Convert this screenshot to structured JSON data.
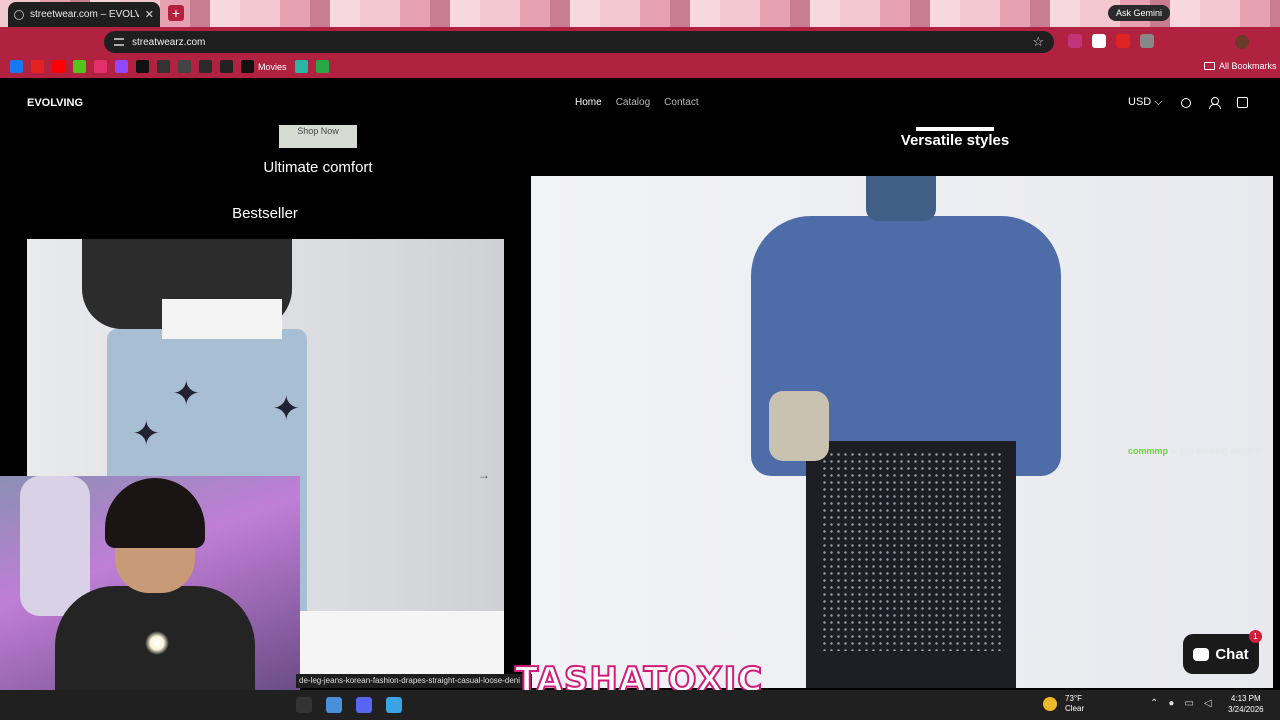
{
  "browser": {
    "tab_title": "streetwear.com – EVOLVING",
    "tab_close": "✕",
    "new_tab": "+",
    "gemini": "Ask Gemini",
    "url": "streatwearz.com",
    "bookmark_movies": "Movies",
    "all_bookmarks": "All Bookmarks"
  },
  "store": {
    "logo": "EVOLVING",
    "nav": [
      "Home",
      "Catalog",
      "Contact"
    ],
    "active_nav": "Home",
    "currency": "USD ⌵",
    "shop_now": "Shop Now",
    "ultimate_comfort": "Ultimate comfort",
    "bestseller": "Bestseller",
    "versatile_styles": "Versatile styles",
    "carousel_arrow": "→",
    "chat_label": "Chat",
    "chat_badge": "1"
  },
  "stream": {
    "chat_user": "commmp",
    "chat_message": "ik you thinking about th",
    "hover_url": "de-leg-jeans-korean-fashion-drapes-straight-casual-loose-deni",
    "watermark": "TASHATOXIC"
  },
  "taskbar": {
    "temp": "73°F",
    "condition": "Clear",
    "time": "4:13 PM",
    "date": "3/24/2026"
  },
  "colors": {
    "accent": "#b0223f",
    "store_bg": "#000000",
    "chat_user": "#6cd23c",
    "watermark_stroke": "#d21c7a"
  }
}
